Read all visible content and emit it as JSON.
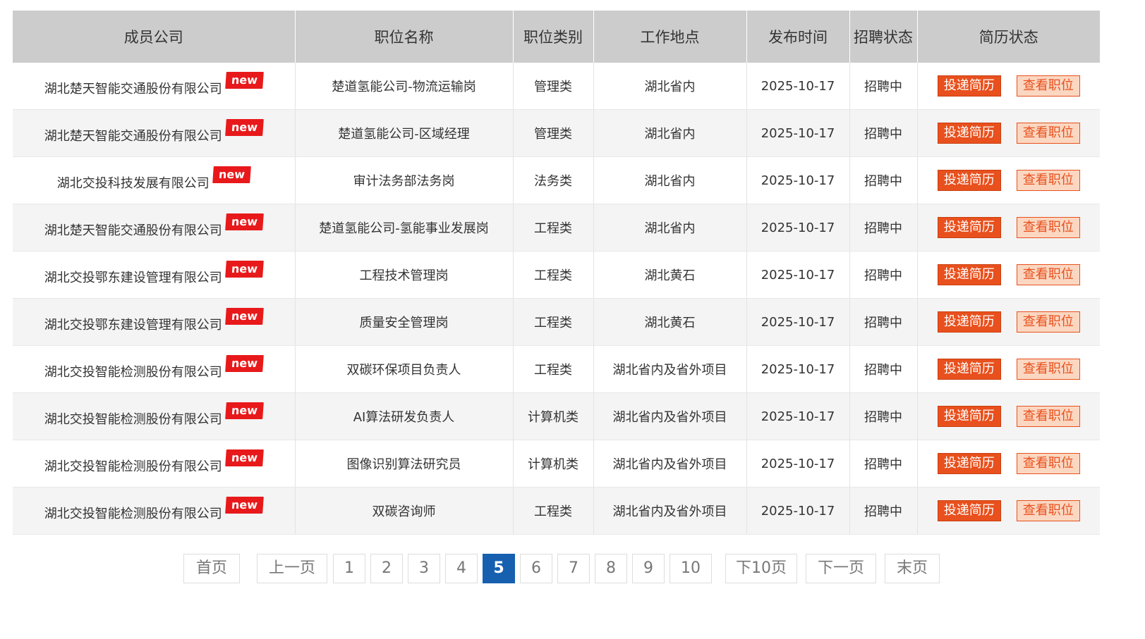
{
  "table": {
    "headers": [
      "成员公司",
      "职位名称",
      "职位类别",
      "工作地点",
      "发布时间",
      "招聘状态",
      "简历状态"
    ],
    "new_label": "new",
    "apply_label": "投递简历",
    "view_label": "查看职位",
    "rows": [
      {
        "company": "湖北楚天智能交通股份有限公司",
        "position": "楚道氢能公司-物流运输岗",
        "category": "管理类",
        "location": "湖北省内",
        "date": "2025-10-17",
        "status": "招聘中"
      },
      {
        "company": "湖北楚天智能交通股份有限公司",
        "position": "楚道氢能公司-区域经理",
        "category": "管理类",
        "location": "湖北省内",
        "date": "2025-10-17",
        "status": "招聘中"
      },
      {
        "company": "湖北交投科技发展有限公司",
        "position": "审计法务部法务岗",
        "category": "法务类",
        "location": "湖北省内",
        "date": "2025-10-17",
        "status": "招聘中"
      },
      {
        "company": "湖北楚天智能交通股份有限公司",
        "position": "楚道氢能公司-氢能事业发展岗",
        "category": "工程类",
        "location": "湖北省内",
        "date": "2025-10-17",
        "status": "招聘中"
      },
      {
        "company": "湖北交投鄂东建设管理有限公司",
        "position": "工程技术管理岗",
        "category": "工程类",
        "location": "湖北黄石",
        "date": "2025-10-17",
        "status": "招聘中"
      },
      {
        "company": "湖北交投鄂东建设管理有限公司",
        "position": "质量安全管理岗",
        "category": "工程类",
        "location": "湖北黄石",
        "date": "2025-10-17",
        "status": "招聘中"
      },
      {
        "company": "湖北交投智能检测股份有限公司",
        "position": "双碳环保项目负责人",
        "category": "工程类",
        "location": "湖北省内及省外项目",
        "date": "2025-10-17",
        "status": "招聘中"
      },
      {
        "company": "湖北交投智能检测股份有限公司",
        "position": "AI算法研发负责人",
        "category": "计算机类",
        "location": "湖北省内及省外项目",
        "date": "2025-10-17",
        "status": "招聘中"
      },
      {
        "company": "湖北交投智能检测股份有限公司",
        "position": "图像识别算法研究员",
        "category": "计算机类",
        "location": "湖北省内及省外项目",
        "date": "2025-10-17",
        "status": "招聘中"
      },
      {
        "company": "湖北交投智能检测股份有限公司",
        "position": "双碳咨询师",
        "category": "工程类",
        "location": "湖北省内及省外项目",
        "date": "2025-10-17",
        "status": "招聘中"
      }
    ]
  },
  "pagination": {
    "first": "首页",
    "prev": "上一页",
    "pages": [
      "1",
      "2",
      "3",
      "4",
      "5",
      "6",
      "7",
      "8",
      "9",
      "10"
    ],
    "current": "5",
    "next10": "下10页",
    "next": "下一页",
    "last": "末页"
  },
  "colors": {
    "header_bg": "#cccccc",
    "new_badge": "#e8191b",
    "apply_button": "#e8501d",
    "view_button_bg": "#fbd7c1",
    "active_page": "#1760b0"
  }
}
